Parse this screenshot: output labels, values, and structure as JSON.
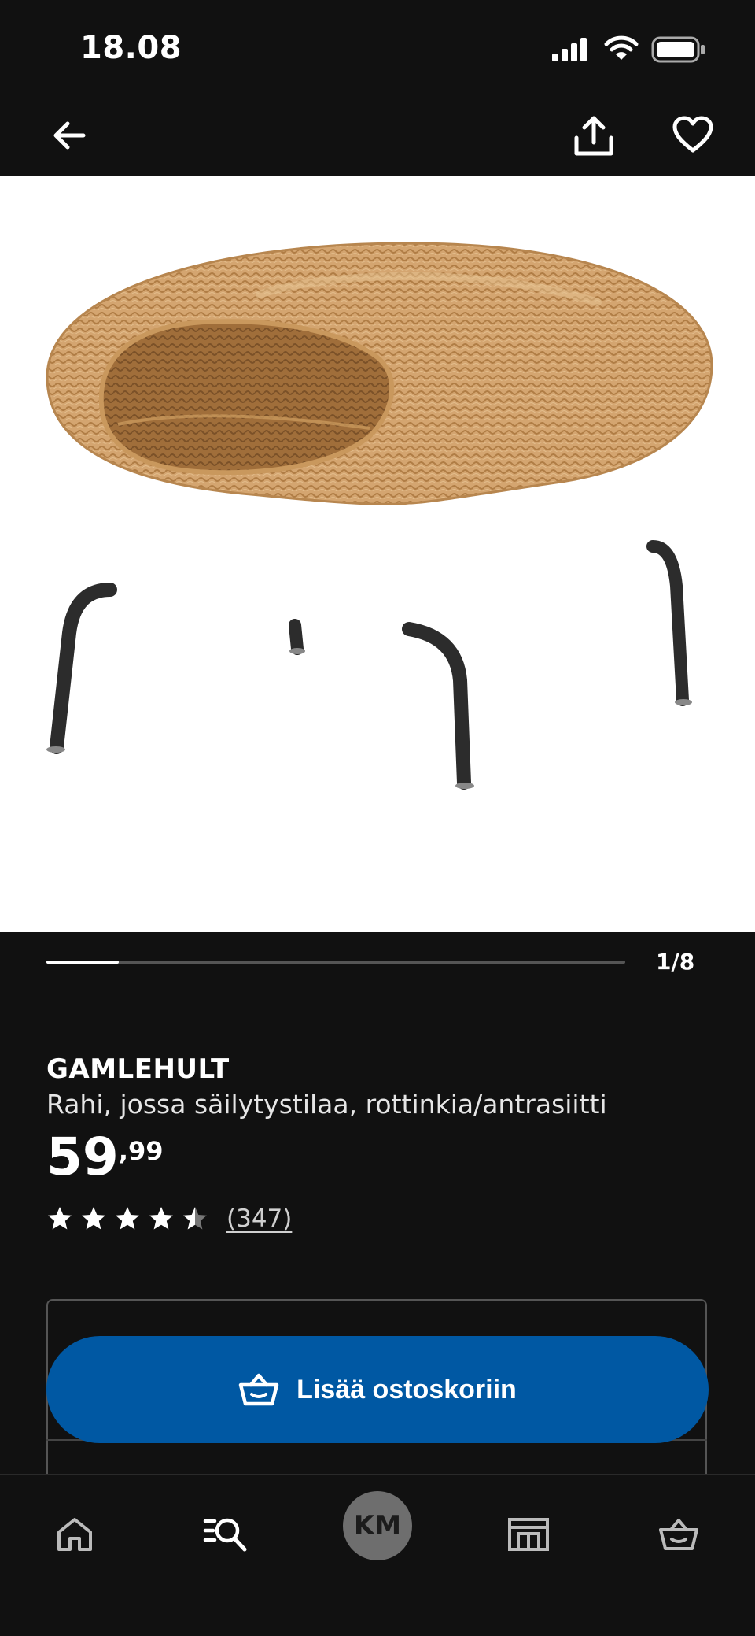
{
  "status_bar": {
    "time": "18.08"
  },
  "app_bar": {
    "icons": [
      "back-arrow-icon",
      "share-icon",
      "heart-icon"
    ]
  },
  "carousel": {
    "counter": "1/8",
    "current": 1,
    "total": 8
  },
  "product": {
    "name": "GAMLEHULT",
    "description": "Rahi, jossa säilytystilaa, rottinkia/antrasiitti",
    "price_integer": "59",
    "price_decimal": ",99",
    "rating": 4.5,
    "rating_max": 5,
    "review_count": "(347)"
  },
  "actions": {
    "add_to_cart_label": "Lisää ostoskoriin"
  },
  "bottom_nav": {
    "items": [
      "home-icon",
      "search-icon",
      "profile-avatar",
      "store-icon",
      "cart-icon"
    ],
    "avatar_initials": "KM"
  },
  "colors": {
    "background": "#111111",
    "accent_blue": "#0058a3",
    "image_bg": "#ffffff"
  }
}
